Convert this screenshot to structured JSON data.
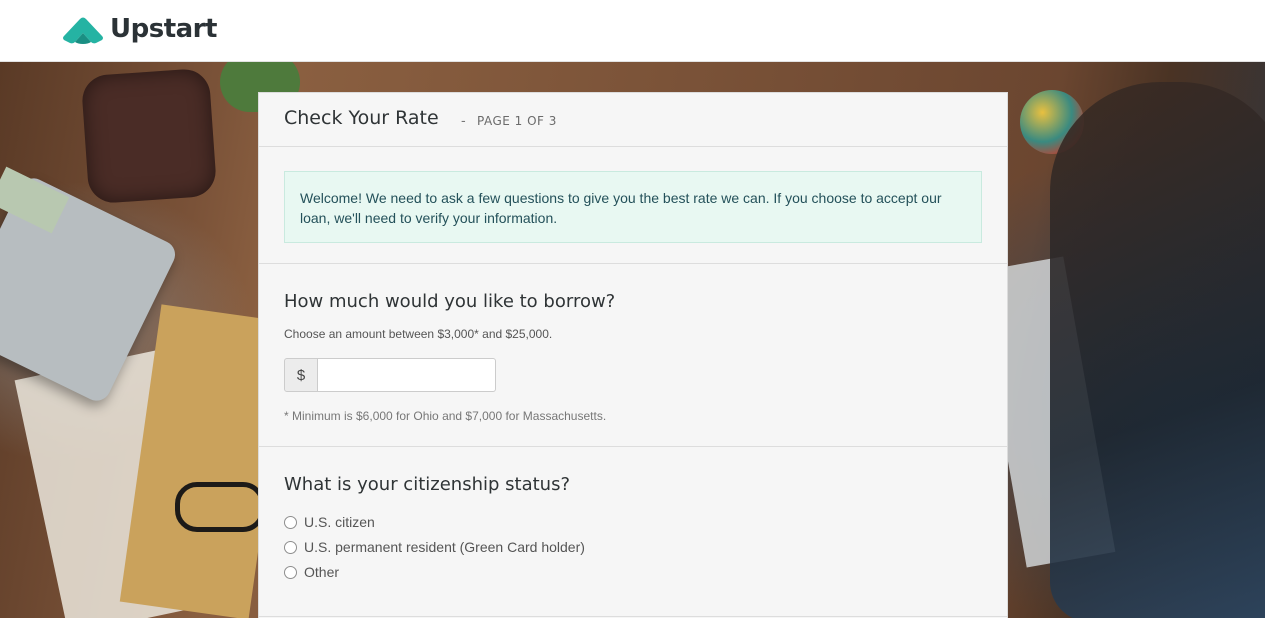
{
  "brand": {
    "name": "Upstart",
    "accent": "#25b3a3"
  },
  "form": {
    "title": "Check Your Rate",
    "separator": "-",
    "page_indicator": "PAGE 1 OF 3",
    "welcome": "Welcome! We need to ask a few questions to give you the best rate we can. If you choose to accept our loan, we'll need to verify your information.",
    "amount": {
      "question": "How much would you like to borrow?",
      "hint": "Choose an amount between $3,000* and $25,000.",
      "currency_symbol": "$",
      "value": "",
      "footnote": "* Minimum is $6,000 for Ohio and $7,000 for Massachusetts."
    },
    "citizenship": {
      "question": "What is your citizenship status?",
      "options": [
        {
          "label": "U.S. citizen",
          "selected": false
        },
        {
          "label": "U.S. permanent resident (Green Card holder)",
          "selected": false
        },
        {
          "label": "Other",
          "selected": false
        }
      ]
    }
  }
}
